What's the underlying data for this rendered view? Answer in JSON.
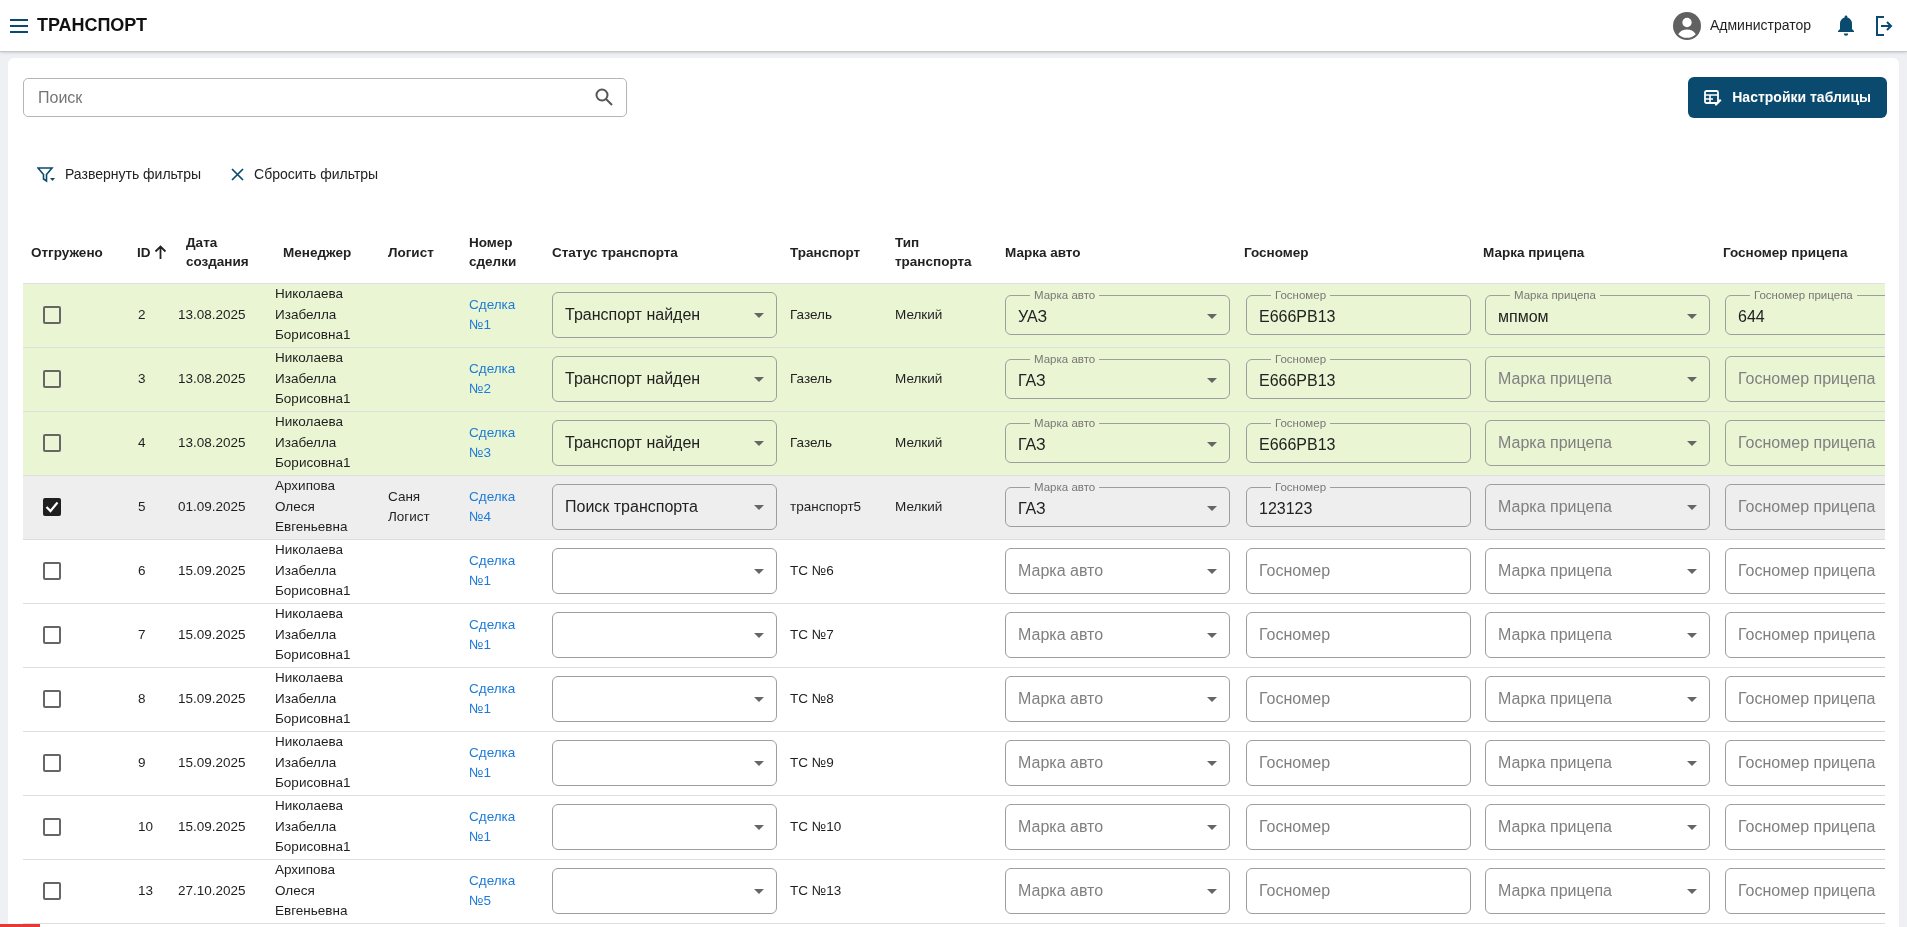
{
  "app_bar": {
    "title": "ТРАНСПОРТ",
    "user": "Администратор"
  },
  "search": {
    "placeholder": "Поиск"
  },
  "settings_button": "Настройки таблицы",
  "filter_actions": [
    {
      "kind": "expand",
      "label": "Развернуть фильтры"
    },
    {
      "kind": "reset",
      "label": "Сбросить фильтры"
    }
  ],
  "table": {
    "columns": [
      {
        "label": "Отгружено"
      },
      {
        "label": "ID",
        "sorted": true
      },
      {
        "label": "Дата создания"
      },
      {
        "label": "Менеджер"
      },
      {
        "label": "Логист"
      },
      {
        "label": "Номер сделки"
      },
      {
        "label": "Статус транспорта"
      },
      {
        "label": "Транспорт"
      },
      {
        "label": "Тип транспорта"
      },
      {
        "label": "Марка авто"
      },
      {
        "label": "Госномер"
      },
      {
        "label": "Марка прицепа"
      },
      {
        "label": "Госномер прицепа"
      }
    ],
    "rows": [
      {
        "color": "#eaf5d3",
        "checked": false,
        "id": "2",
        "date": "13.08.2025",
        "manager": "Николаева Изабелла Борисовна1",
        "deal": "Сделка №1",
        "status": {
          "value": "Транспорт найден"
        },
        "transport": "Газель",
        "type": "Мелкий",
        "fields": [
          {
            "kind": "select",
            "label": "Марка авто",
            "value": "УАЗ"
          },
          {
            "kind": "input",
            "label": "Госномер",
            "value": "Е666РВ13"
          },
          {
            "kind": "select",
            "label": "Марка прицепа",
            "value": "мпмом"
          },
          {
            "kind": "input",
            "label": "Госномер прицепа",
            "value": "644"
          }
        ]
      },
      {
        "color": "#eaf5d3",
        "checked": false,
        "id": "3",
        "date": "13.08.2025",
        "manager": "Николаева Изабелла Борисовна1",
        "deal": "Сделка №2",
        "status": {
          "value": "Транспорт найден"
        },
        "transport": "Газель",
        "type": "Мелкий",
        "fields": [
          {
            "kind": "select",
            "label": "Марка авто",
            "value": "ГАЗ"
          },
          {
            "kind": "input",
            "label": "Госномер",
            "value": "Е666РВ13"
          },
          {
            "kind": "select",
            "placeholder": "Марка прицепа"
          },
          {
            "kind": "input",
            "placeholder": "Госномер прицепа"
          }
        ]
      },
      {
        "color": "#eaf5d3",
        "checked": false,
        "id": "4",
        "date": "13.08.2025",
        "manager": "Николаева Изабелла Борисовна1",
        "deal": "Сделка №3",
        "status": {
          "value": "Транспорт найден"
        },
        "transport": "Газель",
        "type": "Мелкий",
        "fields": [
          {
            "kind": "select",
            "label": "Марка авто",
            "value": "ГАЗ"
          },
          {
            "kind": "input",
            "label": "Госномер",
            "value": "Е666РВ13"
          },
          {
            "kind": "select",
            "placeholder": "Марка прицепа"
          },
          {
            "kind": "input",
            "placeholder": "Госномер прицепа"
          }
        ]
      },
      {
        "color": "#eeeeee",
        "checked": true,
        "id": "5",
        "date": "01.09.2025",
        "manager": "Архипова Олеся Евгеньевна",
        "logist": "Саня Логист",
        "deal": "Сделка №4",
        "status": {
          "value": "Поиск транспорта"
        },
        "transport": "транспорт5",
        "type": "Мелкий",
        "fields": [
          {
            "kind": "select",
            "label": "Марка авто",
            "value": "ГАЗ"
          },
          {
            "kind": "input",
            "label": "Госномер",
            "value": "123123"
          },
          {
            "kind": "select",
            "placeholder": "Марка прицепа"
          },
          {
            "kind": "input",
            "placeholder": "Госномер прицепа"
          }
        ]
      },
      {
        "color": "#ffffff",
        "checked": false,
        "id": "6",
        "date": "15.09.2025",
        "manager": "Николаева Изабелла Борисовна1",
        "deal": "Сделка №1",
        "transport": "ТС №6",
        "fields": [
          {
            "kind": "select",
            "placeholder": "Марка авто"
          },
          {
            "kind": "input",
            "placeholder": "Госномер"
          },
          {
            "kind": "select",
            "placeholder": "Марка прицепа"
          },
          {
            "kind": "input",
            "placeholder": "Госномер прицепа"
          }
        ]
      },
      {
        "color": "#ffffff",
        "checked": false,
        "id": "7",
        "date": "15.09.2025",
        "manager": "Николаева Изабелла Борисовна1",
        "deal": "Сделка №1",
        "transport": "ТС №7",
        "fields": [
          {
            "kind": "select",
            "placeholder": "Марка авто"
          },
          {
            "kind": "input",
            "placeholder": "Госномер"
          },
          {
            "kind": "select",
            "placeholder": "Марка прицепа"
          },
          {
            "kind": "input",
            "placeholder": "Госномер прицепа"
          }
        ]
      },
      {
        "color": "#ffffff",
        "checked": false,
        "id": "8",
        "date": "15.09.2025",
        "manager": "Николаева Изабелла Борисовна1",
        "deal": "Сделка №1",
        "transport": "ТС №8",
        "fields": [
          {
            "kind": "select",
            "placeholder": "Марка авто"
          },
          {
            "kind": "input",
            "placeholder": "Госномер"
          },
          {
            "kind": "select",
            "placeholder": "Марка прицепа"
          },
          {
            "kind": "input",
            "placeholder": "Госномер прицепа"
          }
        ]
      },
      {
        "color": "#ffffff",
        "checked": false,
        "id": "9",
        "date": "15.09.2025",
        "manager": "Николаева Изабелла Борисовна1",
        "deal": "Сделка №1",
        "transport": "ТС №9",
        "fields": [
          {
            "kind": "select",
            "placeholder": "Марка авто"
          },
          {
            "kind": "input",
            "placeholder": "Госномер"
          },
          {
            "kind": "select",
            "placeholder": "Марка прицепа"
          },
          {
            "kind": "input",
            "placeholder": "Госномер прицепа"
          }
        ]
      },
      {
        "color": "#ffffff",
        "checked": false,
        "id": "10",
        "date": "15.09.2025",
        "manager": "Николаева Изабелла Борисовна1",
        "deal": "Сделка №1",
        "transport": "ТС №10",
        "fields": [
          {
            "kind": "select",
            "placeholder": "Марка авто"
          },
          {
            "kind": "input",
            "placeholder": "Госномер"
          },
          {
            "kind": "select",
            "placeholder": "Марка прицепа"
          },
          {
            "kind": "input",
            "placeholder": "Госномер прицепа"
          }
        ]
      },
      {
        "color": "#ffffff",
        "checked": false,
        "id": "13",
        "date": "27.10.2025",
        "manager": "Архипова Олеся Евгеньевна",
        "deal": "Сделка №5",
        "transport": "ТС №13",
        "fields": [
          {
            "kind": "select",
            "placeholder": "Марка авто"
          },
          {
            "kind": "input",
            "placeholder": "Госномер"
          },
          {
            "kind": "select",
            "placeholder": "Марка прицепа"
          },
          {
            "kind": "input",
            "placeholder": "Госномер прицепа"
          }
        ]
      }
    ]
  }
}
